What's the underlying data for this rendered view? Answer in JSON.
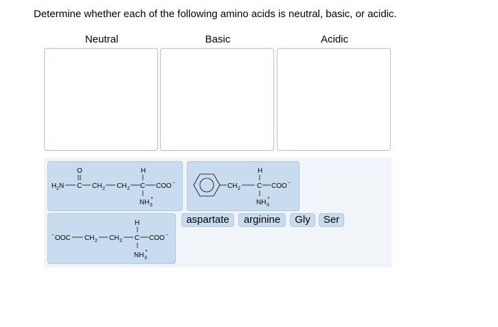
{
  "question": {
    "text": "Determine whether each of the following amino acids is neutral, basic, or acidic."
  },
  "categories": [
    {
      "label": "Neutral"
    },
    {
      "label": "Basic"
    },
    {
      "label": "Acidic"
    }
  ],
  "structures": {
    "glutamine": {
      "o": "O",
      "h": "H",
      "h2n": "H",
      "h2n_sub": "2",
      "h2n_n": "N",
      "c1": "C",
      "ch2a": "CH",
      "ch2a_sub": "2",
      "ch2b": "CH",
      "ch2b_sub": "2",
      "c2": "C",
      "coo": "COO",
      "coo_charge": "−",
      "nh3": "NH",
      "nh3_sub": "3",
      "nh3_charge": "+"
    },
    "phenylalanine": {
      "h": "H",
      "ch2": "CH",
      "ch2_sub": "2",
      "c": "C",
      "coo": "COO",
      "coo_charge": "−",
      "nh3": "NH",
      "nh3_sub": "3",
      "nh3_charge": "+"
    },
    "glutamate": {
      "ooc_charge": "−",
      "ooc": "OOC",
      "ch2a": "CH",
      "ch2a_sub": "2",
      "ch2b": "CH",
      "ch2b_sub": "2",
      "h": "H",
      "c": "C",
      "coo": "COO",
      "coo_charge": "−",
      "nh3": "NH",
      "nh3_sub": "3",
      "nh3_charge": "+"
    }
  },
  "chips": [
    {
      "label": "aspartate"
    },
    {
      "label": "arginine"
    },
    {
      "label": "Gly"
    },
    {
      "label": "Ser"
    }
  ]
}
